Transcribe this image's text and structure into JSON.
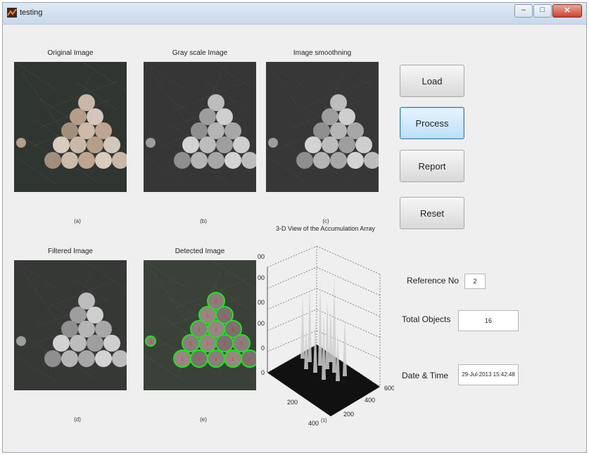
{
  "window": {
    "title": "testing"
  },
  "panels": [
    {
      "title": "Original Image",
      "caption": "(a)"
    },
    {
      "title": "Gray scale Image",
      "caption": "(b)"
    },
    {
      "title": "Image smoothning",
      "caption": "(c)"
    },
    {
      "title": "Filtered Image",
      "caption": "(d)"
    },
    {
      "title": "Detected Image",
      "caption": "(e)"
    }
  ],
  "plot": {
    "title": "3-D View of the Accumulation Array",
    "z_ticks": [
      "0",
      "0",
      "00",
      "00",
      "00",
      "00"
    ],
    "x_ticks": [
      "200",
      "400"
    ],
    "y_ticks": [
      "200",
      "400",
      "600"
    ],
    "axis_marker": "(1)"
  },
  "buttons": {
    "load": "Load",
    "process": "Process",
    "report": "Report",
    "reset": "Reset"
  },
  "fields": {
    "reference_label": "Reference No",
    "reference_value": "2",
    "total_label": "Total Objects",
    "total_value": "16",
    "datetime_label": "Date & Time",
    "datetime_value": "29-Jul-2013 15:42:48"
  },
  "detected_labels": [
    "2",
    "1",
    "1",
    "1",
    "1",
    "8",
    "1",
    "1",
    "1",
    "5",
    "1",
    "1",
    "1",
    "1",
    "1",
    "1"
  ],
  "colors": {
    "process_button_border": "#3c7fb1",
    "detected_circle": "#22e022"
  },
  "icons": {
    "app": "matlab-figure-icon",
    "minimize": "minimize-icon",
    "maximize": "maximize-icon",
    "close": "close-icon"
  }
}
